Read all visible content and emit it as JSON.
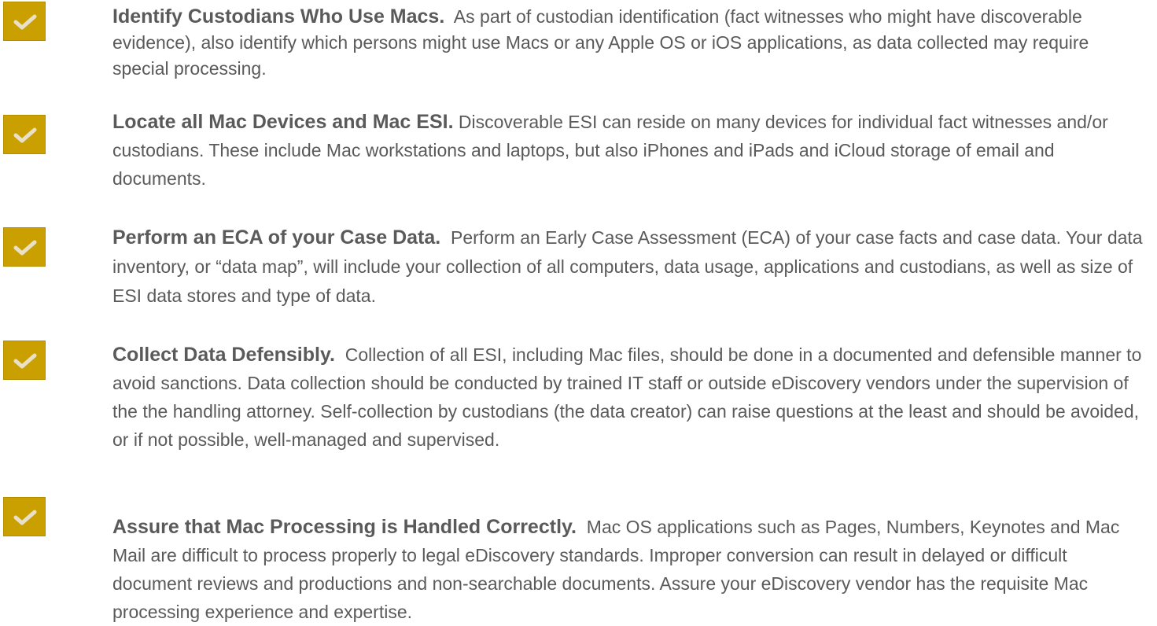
{
  "items": [
    {
      "heading": "Identify Custodians Who Use Macs.",
      "body": "As part of custodian identification (fact witnesses who might have discoverable evidence), also identify which persons might use Macs or any Apple OS or iOS applications, as data collected may require special processing."
    },
    {
      "heading": "Locate all Mac Devices and Mac ESI.",
      "body": "Discoverable ESI can reside on many devices for individual fact witnesses and/or custodians.  These include Mac workstations and laptops, but also iPhones and iPads and iCloud storage of email and documents."
    },
    {
      "heading": "Perform an ECA of your Case Data.",
      "body": "Perform an Early Case Assessment (ECA) of your case facts and case data. Your data inventory, or “data map”, will include your collection of all computers, data usage, applications and custodians, as well as size of ESI data stores and type of data."
    },
    {
      "heading": "Collect Data Defensibly.",
      "body": "Collection of all ESI, including Mac files, should be done in a documented and defensible manner to avoid sanctions.   Data collection should be conducted by trained IT staff or outside eDiscovery vendors under the supervision of the the handling attorney.  Self-collection by custodians (the data creator) can raise questions at the least and should be avoided, or if not possible, well-managed and supervised."
    },
    {
      "heading": "Assure that Mac Processing is Handled Correctly.",
      "body": "Mac OS applications such as Pages, Numbers, Keynotes and Mac Mail are difficult to process properly to legal eDiscovery standards.  Improper conversion can result in delayed or difficult document reviews and productions and non-searchable documents. Assure your eDiscovery vendor has the requisite Mac processing experience and expertise."
    }
  ],
  "icons": {
    "check": "checkmark-icon"
  },
  "colors": {
    "check_background": "#c9a000",
    "text": "#5a5a5a"
  }
}
